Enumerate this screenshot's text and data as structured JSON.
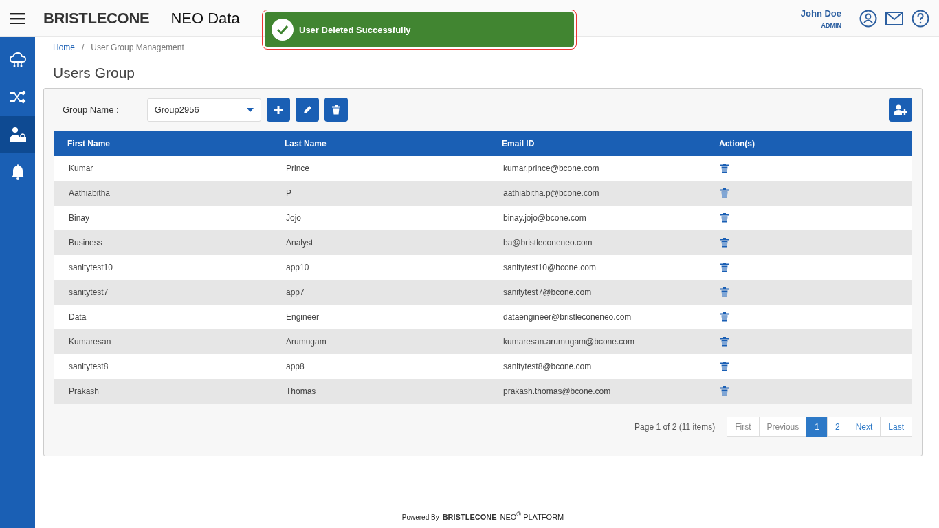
{
  "header": {
    "logo": "BRISTLECONE",
    "title": "NEO Data",
    "user_name": "John Doe",
    "user_role": "ADMIN"
  },
  "toast": {
    "message": "User Deleted Successfully",
    "kind": "success"
  },
  "sidebar": {
    "items": [
      {
        "kind": "cloud",
        "selected": false
      },
      {
        "kind": "shuffle",
        "selected": false
      },
      {
        "kind": "user-lock",
        "selected": true
      },
      {
        "kind": "bell",
        "selected": false
      }
    ]
  },
  "breadcrumb": {
    "separator": "/",
    "items": [
      {
        "label": "Home",
        "link": true
      },
      {
        "label": "User Group Management",
        "link": false
      }
    ]
  },
  "page_title": "Users Group",
  "group": {
    "label": "Group Name :",
    "value": "Group2956"
  },
  "table": {
    "columns": [
      "First Name",
      "Last Name",
      "Email ID",
      "Action(s)"
    ],
    "rows": [
      {
        "first": "Kumar",
        "last": "Prince",
        "email": "kumar.prince@bcone.com"
      },
      {
        "first": "Aathiabitha",
        "last": "P",
        "email": "aathiabitha.p@bcone.com"
      },
      {
        "first": "Binay",
        "last": "Jojo",
        "email": "binay.jojo@bcone.com"
      },
      {
        "first": "Business",
        "last": "Analyst",
        "email": "ba@bristleconeneo.com"
      },
      {
        "first": "sanitytest10",
        "last": "app10",
        "email": "sanitytest10@bcone.com"
      },
      {
        "first": "sanitytest7",
        "last": "app7",
        "email": "sanitytest7@bcone.com"
      },
      {
        "first": "Data",
        "last": "Engineer",
        "email": "dataengineer@bristleconeneo.com"
      },
      {
        "first": "Kumaresan",
        "last": "Arumugam",
        "email": "kumaresan.arumugam@bcone.com"
      },
      {
        "first": "sanitytest8",
        "last": "app8",
        "email": "sanitytest8@bcone.com"
      },
      {
        "first": "Prakash",
        "last": "Thomas",
        "email": "prakash.thomas@bcone.com"
      }
    ]
  },
  "pagination": {
    "summary": "Page 1 of 2 (11 items)",
    "buttons": [
      {
        "label": "First",
        "selected": false,
        "disabled": true
      },
      {
        "label": "Previous",
        "selected": false,
        "disabled": true
      },
      {
        "label": "1",
        "selected": true,
        "disabled": false
      },
      {
        "label": "2",
        "selected": false,
        "disabled": false
      },
      {
        "label": "Next",
        "selected": false,
        "disabled": false
      },
      {
        "label": "Last",
        "selected": false,
        "disabled": false
      }
    ]
  },
  "footer": {
    "powered_by": "Powered By",
    "logo": "BRISTLECONE",
    "product": "NEO$^{®}$ PLATFORM"
  }
}
